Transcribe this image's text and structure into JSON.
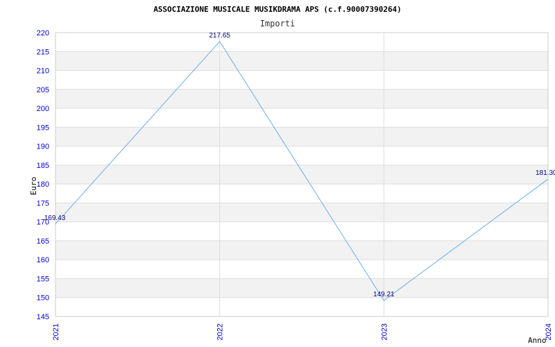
{
  "chart_data": {
    "type": "line",
    "title": "ASSOCIAZIONE MUSICALE MUSIKDRAMA APS (c.f.90007390264)",
    "subtitle": "Importi",
    "xlabel": "Anno",
    "ylabel": "Euro",
    "categories": [
      "2021",
      "2022",
      "2023",
      "2024"
    ],
    "series": [
      {
        "values": [
          169.43,
          217.65,
          149.21,
          181.3
        ],
        "labels": [
          "169.43",
          "217.65",
          "149.21",
          "181.30"
        ]
      }
    ],
    "ylim": [
      145,
      220
    ],
    "yticks": [
      145,
      150,
      155,
      160,
      165,
      170,
      175,
      180,
      185,
      190,
      195,
      200,
      205,
      210,
      215,
      220
    ],
    "grid": true,
    "colors": {
      "line": "#6aaeea",
      "band": "#f2f2f2",
      "gridline": "#dddddd",
      "tick_text": "#0000cc",
      "data_label": "#000080"
    }
  }
}
